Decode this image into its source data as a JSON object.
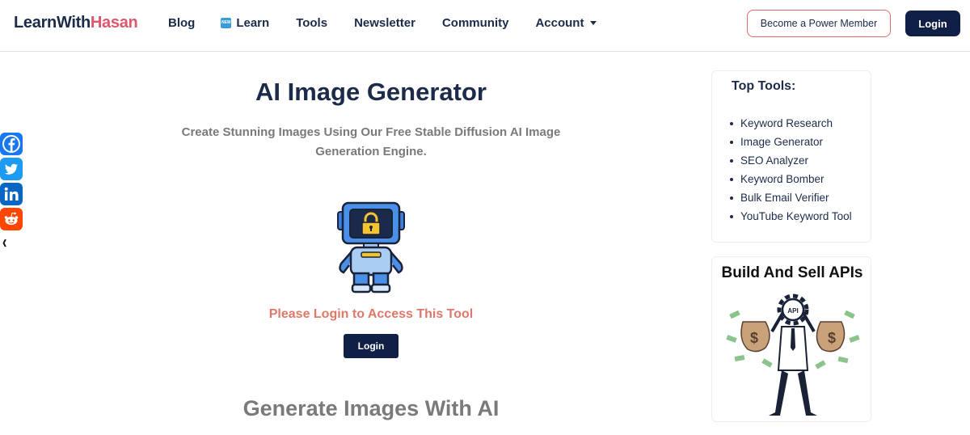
{
  "header": {
    "logo_main": "LearnWith",
    "logo_accent": "Hasan",
    "nav": {
      "blog": "Blog",
      "learn_badge": "NEW",
      "learn": "Learn",
      "tools": "Tools",
      "newsletter": "Newsletter",
      "community": "Community",
      "account": "Account"
    },
    "power_member_label": "Become a Power Member",
    "login_label": "Login"
  },
  "share": {
    "icons": [
      "facebook-icon",
      "twitter-icon",
      "linkedin-icon",
      "reddit-icon"
    ],
    "colors": {
      "facebook": "#1877f2",
      "twitter": "#1d9bf0",
      "linkedin": "#0a66c2",
      "reddit": "#ff4500"
    }
  },
  "main": {
    "title": "AI Image Generator",
    "subtitle": "Create Stunning Images Using Our Free Stable Diffusion AI Image Generation Engine.",
    "login_message": "Please Login to Access This Tool",
    "login_button": "Login",
    "section_title": "Generate Images With AI"
  },
  "sidebar": {
    "top_tools_title": "Top Tools:",
    "tools": [
      "Keyword Research",
      "Image Generator",
      "SEO Analyzer",
      "Keyword Bomber",
      "Bulk Email Verifier",
      "YouTube Keyword Tool"
    ],
    "promo_title": "Build And Sell APIs",
    "promo_gear_text": "API"
  },
  "colors": {
    "brand_navy": "#0f1f45",
    "accent_pink": "#e0566b",
    "login_message": "#e0786a"
  }
}
